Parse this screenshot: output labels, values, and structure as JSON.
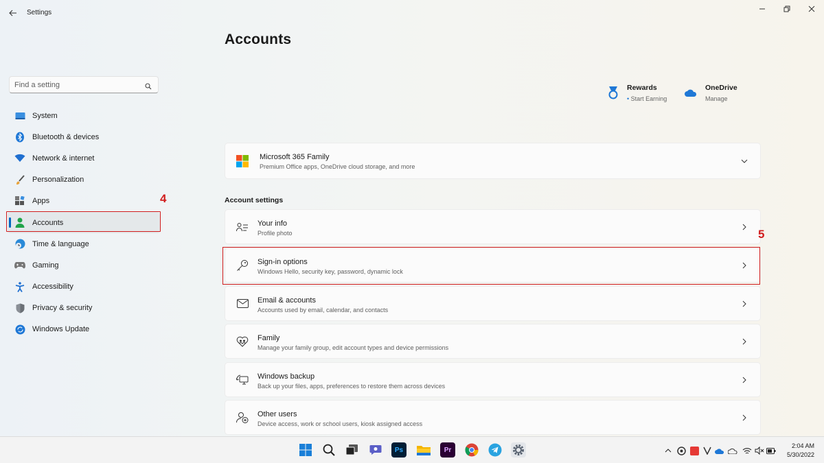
{
  "window": {
    "app_title": "Settings"
  },
  "sidebar": {
    "search_placeholder": "Find a setting",
    "items": [
      {
        "label": "System",
        "icon": "monitor-icon",
        "active": false
      },
      {
        "label": "Bluetooth & devices",
        "icon": "bluetooth-icon",
        "active": false
      },
      {
        "label": "Network & internet",
        "icon": "wifi-icon",
        "active": false
      },
      {
        "label": "Personalization",
        "icon": "brush-icon",
        "active": false
      },
      {
        "label": "Apps",
        "icon": "apps-icon",
        "active": false
      },
      {
        "label": "Accounts",
        "icon": "person-icon",
        "active": true
      },
      {
        "label": "Time & language",
        "icon": "globe-clock-icon",
        "active": false
      },
      {
        "label": "Gaming",
        "icon": "gamepad-icon",
        "active": false
      },
      {
        "label": "Accessibility",
        "icon": "accessibility-icon",
        "active": false
      },
      {
        "label": "Privacy & security",
        "icon": "shield-icon",
        "active": false
      },
      {
        "label": "Windows Update",
        "icon": "update-icon",
        "active": false
      }
    ]
  },
  "annotations": {
    "step_accounts": "4",
    "step_signin": "5"
  },
  "main": {
    "title": "Accounts",
    "rewards": {
      "title": "Rewards",
      "subtitle": "Start Earning"
    },
    "onedrive": {
      "title": "OneDrive",
      "subtitle": "Manage"
    },
    "m365": {
      "title": "Microsoft 365 Family",
      "subtitle": "Premium Office apps, OneDrive cloud storage, and more"
    },
    "section_title": "Account settings",
    "settings": [
      {
        "title": "Your info",
        "subtitle": "Profile photo",
        "icon": "user-card-icon"
      },
      {
        "title": "Sign-in options",
        "subtitle": "Windows Hello, security key, password, dynamic lock",
        "icon": "key-icon"
      },
      {
        "title": "Email & accounts",
        "subtitle": "Accounts used by email, calendar, and contacts",
        "icon": "mail-icon"
      },
      {
        "title": "Family",
        "subtitle": "Manage your family group, edit account types and device permissions",
        "icon": "heart-people-icon"
      },
      {
        "title": "Windows backup",
        "subtitle": "Back up your files, apps, preferences to restore them across devices",
        "icon": "backup-icon"
      },
      {
        "title": "Other users",
        "subtitle": "Device access, work or school users, kiosk assigned access",
        "icon": "add-user-icon"
      }
    ]
  },
  "taskbar": {
    "time": "2:04 AM",
    "date": "5/30/2022",
    "pinned": [
      "windows-start-icon",
      "search-icon",
      "task-view-icon",
      "chat-icon",
      "photoshop-icon",
      "file-explorer-icon",
      "premiere-icon",
      "chrome-icon",
      "telegram-icon",
      "settings-gear-icon"
    ],
    "pinned_labels": {
      "photoshop": "Ps",
      "premiere": "Pr"
    }
  },
  "colors": {
    "accent": "#0067c0",
    "annotation_red": "#d11d1d"
  }
}
